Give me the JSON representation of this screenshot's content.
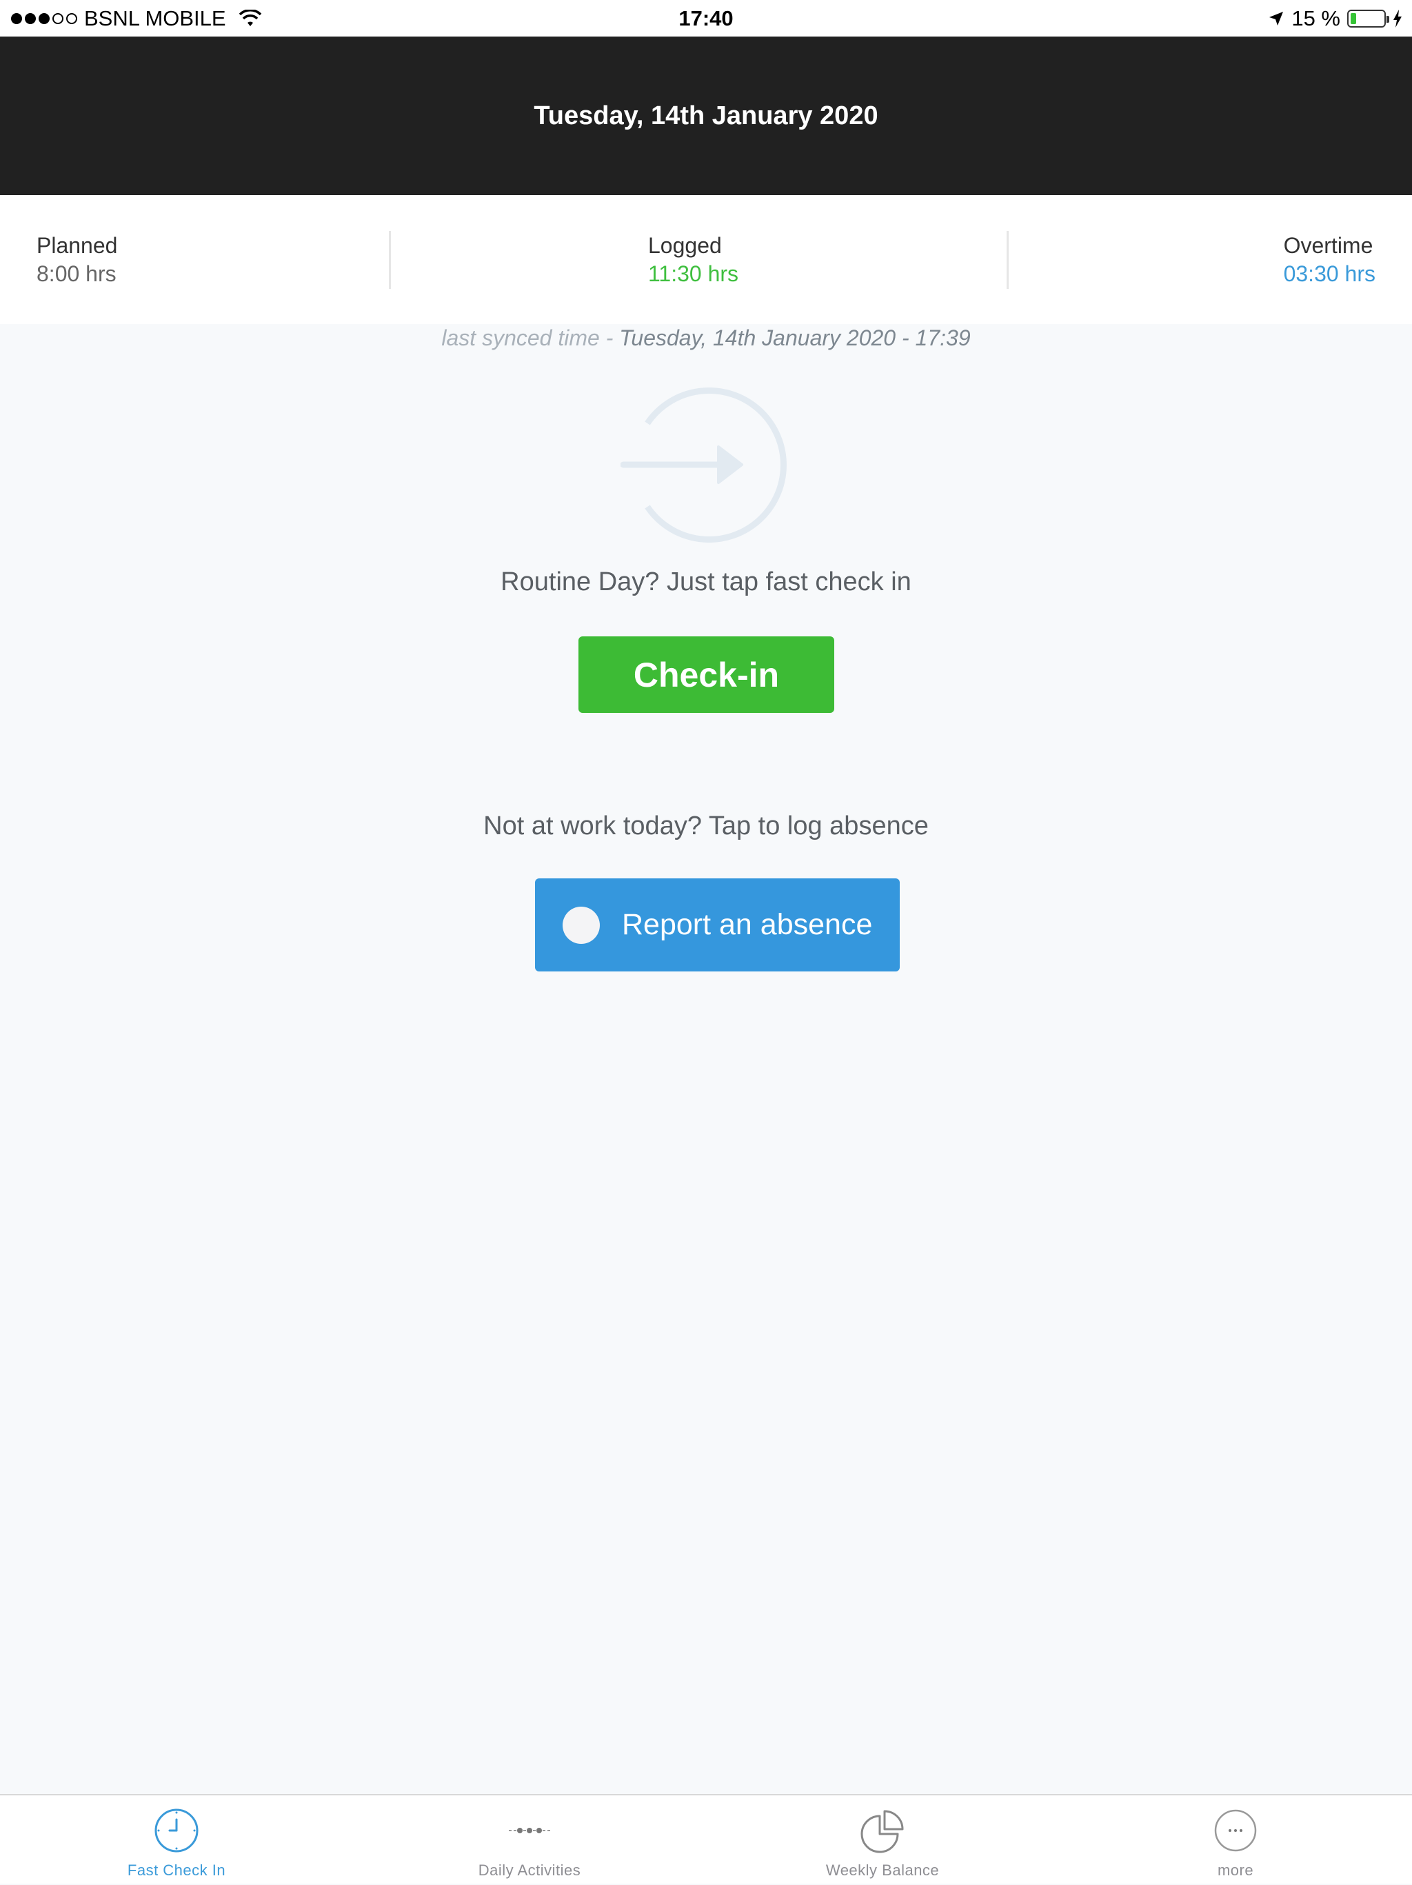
{
  "status_bar": {
    "carrier": "BSNL MOBILE",
    "time": "17:40",
    "battery": "15 %"
  },
  "header": {
    "date": "Tuesday, 14th January 2020"
  },
  "summary": {
    "planned_label": "Planned",
    "planned_value": "8:00 hrs",
    "logged_label": "Logged",
    "logged_value": "11:30 hrs",
    "overtime_label": "Overtime",
    "overtime_value": "03:30 hrs"
  },
  "sync": {
    "prefix": "last synced time - ",
    "timestamp": "Tuesday, 14th January 2020 - 17:39"
  },
  "main": {
    "routine_text": "Routine Day? Just tap fast check in",
    "checkin_label": "Check-in",
    "absence_text": "Not at work today? Tap to log absence",
    "absence_label": "Report an absence"
  },
  "tabs": [
    {
      "label": "Fast Check In",
      "icon": "clock-icon",
      "active": true
    },
    {
      "label": "Daily Activities",
      "icon": "activities-icon",
      "active": false
    },
    {
      "label": "Weekly Balance",
      "icon": "pie-chart-icon",
      "active": false
    },
    {
      "label": "more",
      "icon": "more-icon",
      "active": false
    }
  ],
  "colors": {
    "header_bg": "#212121",
    "checkin_green": "#3dbb35",
    "absence_blue": "#3597dd",
    "logged_green": "#3fbf3f",
    "overtime_blue": "#3a9ad9"
  }
}
